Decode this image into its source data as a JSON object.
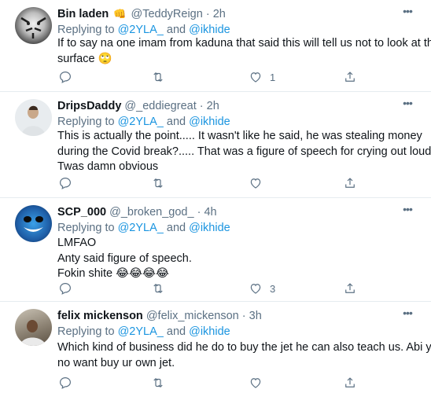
{
  "tweets": [
    {
      "name": "Bin laden",
      "badge": "👊",
      "handle": "@TeddyReign",
      "time": "2h",
      "replying_prefix": "Replying to",
      "mention1": "@2YLA_",
      "and": "and",
      "mention2": "@ikhide",
      "lines": [
        "If to say na one imam from kaduna that said this will tell us not to look at the",
        "surface 🙄"
      ],
      "reply_count": "",
      "retweet_count": "",
      "like_count": "1",
      "avatar": "tiger"
    },
    {
      "name": "DripsDaddy",
      "badge": "",
      "handle": "@_eddiegreat",
      "time": "2h",
      "replying_prefix": "Replying to",
      "mention1": "@2YLA_",
      "and": "and",
      "mention2": "@ikhide",
      "lines": [
        "This is actually the point..... It wasn't like he said, he was stealing money",
        "during the Covid break?..... That was a figure of speech for crying out loud....",
        "Twas damn obvious"
      ],
      "reply_count": "",
      "retweet_count": "",
      "like_count": "",
      "avatar": "person-light"
    },
    {
      "name": "SCP_000",
      "badge": "",
      "handle": "@_broken_god_",
      "time": "4h",
      "replying_prefix": "Replying to",
      "mention1": "@2YLA_",
      "and": "and",
      "mention2": "@ikhide",
      "lines": [
        "LMFAO",
        "Anty said figure of speech.",
        "Fokin shite 😂😂😂😂"
      ],
      "reply_count": "",
      "retweet_count": "",
      "like_count": "3",
      "avatar": "blue-face"
    },
    {
      "name": "felix mickenson",
      "badge": "",
      "handle": "@felix_mickenson",
      "time": "3h",
      "replying_prefix": "Replying to",
      "mention1": "@2YLA_",
      "and": "and",
      "mention2": "@ikhide",
      "lines": [
        "Which kind of business did he do to buy the jet he can also teach us. Abi you",
        "no want buy ur own jet."
      ],
      "reply_count": "",
      "retweet_count": "",
      "like_count": "",
      "avatar": "person-photo"
    }
  ],
  "colors": {
    "accent": "#1b95e0",
    "muted": "#5b7083",
    "text": "#0f1419",
    "border": "#e6ecf0"
  }
}
